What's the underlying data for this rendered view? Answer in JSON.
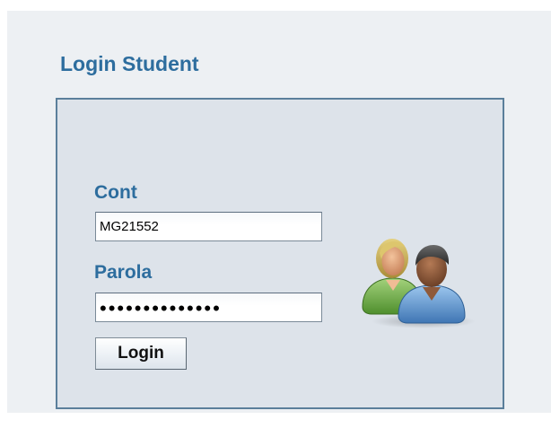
{
  "panel": {
    "title": "Login Student"
  },
  "form": {
    "account_label": "Cont",
    "account_value": "MG21552",
    "password_label": "Parola",
    "password_value": "••••••••••••••",
    "login_button_label": "Login"
  },
  "icons": {
    "users": "users-icon"
  },
  "colors": {
    "accent": "#2d6d9e",
    "panel_background": "#dde3ea",
    "panel_border": "#5b7f9b",
    "page_background": "#edf0f3"
  }
}
